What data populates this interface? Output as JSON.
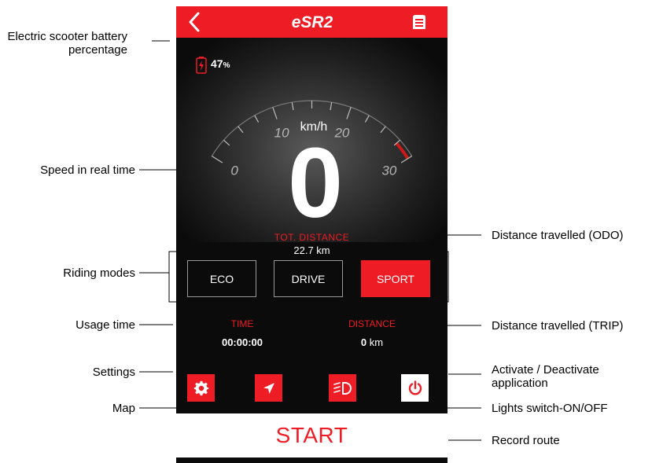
{
  "annotations": {
    "battery": "Electric scooter battery percentage",
    "speed": "Speed in real time",
    "riding_modes": "Riding modes",
    "usage_time": "Usage time",
    "settings": "Settings",
    "map": "Map",
    "odo": "Distance travelled (ODO)",
    "trip": "Distance travelled (TRIP)",
    "activate": "Activate / Deactivate application",
    "lights": "Lights switch-ON/OFF",
    "record": "Record route"
  },
  "header": {
    "logo_text": "eSR2"
  },
  "battery": {
    "percent": "47",
    "unit": "%"
  },
  "speedometer": {
    "unit": "km/h",
    "speed": "0",
    "ticks": [
      "0",
      "10",
      "20",
      "30"
    ]
  },
  "odo": {
    "label": "TOT. DISTANCE",
    "value": "22.7 km"
  },
  "modes": [
    "ECO",
    "DRIVE",
    "SPORT"
  ],
  "active_mode": "SPORT",
  "stats": {
    "time_label": "TIME",
    "time_value": "00:00:00",
    "distance_label": "DISTANCE",
    "distance_value": "0",
    "distance_unit": "km"
  },
  "actions": {
    "settings_icon": "gear-icon",
    "map_icon": "navigation-arrow-icon",
    "lights_icon": "headlight-icon",
    "power_icon": "power-icon"
  },
  "start_label": "START",
  "colors": {
    "accent": "#ee1c24",
    "background": "#0b0b0b"
  }
}
